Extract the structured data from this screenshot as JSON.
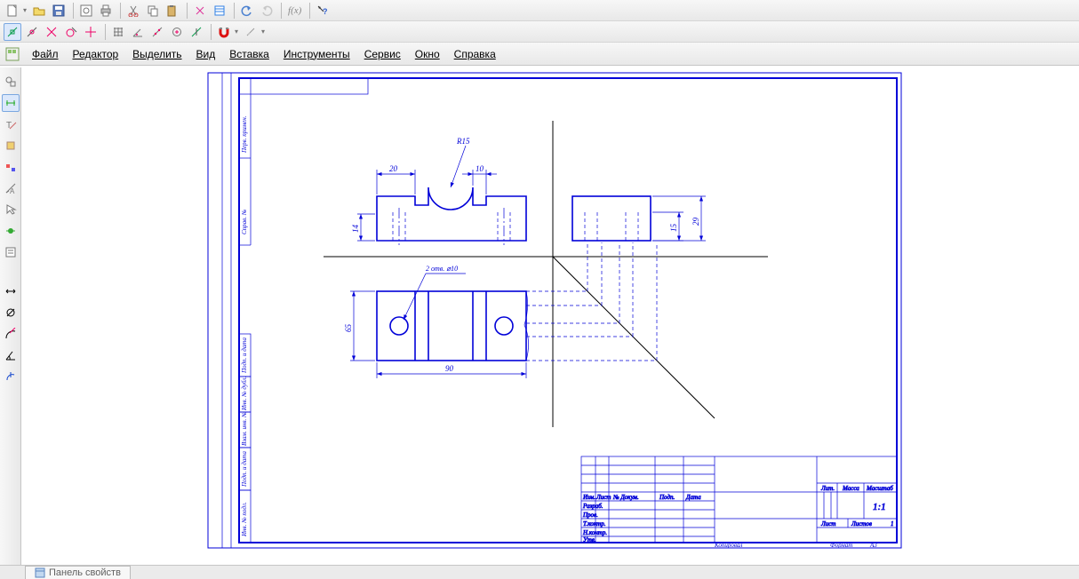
{
  "menu": {
    "file": "Файл",
    "editor": "Редактор",
    "select": "Выделить",
    "view": "Вид",
    "insert": "Вставка",
    "tools": "Инструменты",
    "service": "Сервис",
    "window": "Окно",
    "help": "Справка"
  },
  "panel_tab": "Панель свойств",
  "fx_label": "f(x)",
  "dims": {
    "r15": "R15",
    "d20": "20",
    "d10": "10",
    "d15": "15",
    "d29": "29",
    "d14": "14",
    "d65": "65",
    "d90": "90",
    "holes": "2 отв. ⌀10"
  },
  "titleblock": {
    "izm": "Изм.",
    "list": "Лист",
    "ndok": "№ Докум.",
    "podp": "Подп.",
    "data": "Дата",
    "razrab": "Разраб.",
    "prov": "Пров.",
    "tkontra": "Т.контр.",
    "nkontra": "Н.контр.",
    "utv": "Утв.",
    "lit": "Лит.",
    "massa": "Масса",
    "masshtab": "Масштаб",
    "scale": "1:1",
    "list1": "Лист",
    "listov": "Листов",
    "listov_n": "1",
    "kopiroval": "Копировал",
    "format": "Формат",
    "format_v": "A3"
  },
  "side_labels": {
    "a": "Перв. примен.",
    "b": "Справ. №",
    "c": "Подп. и дата",
    "d": "Инв. № дубл.",
    "e": "Взам. инв. №",
    "f": "Подп. и дата",
    "g": "Инв. № подл."
  }
}
